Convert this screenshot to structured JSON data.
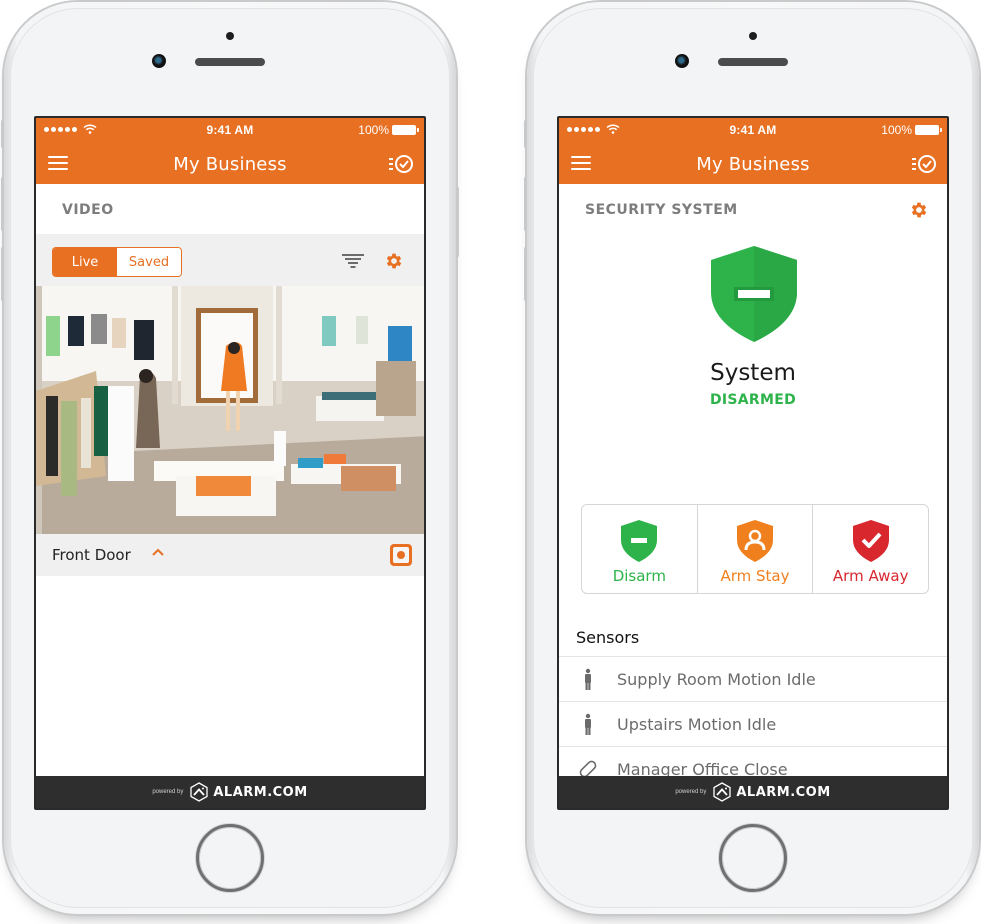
{
  "status_bar": {
    "time": "9:41 AM",
    "battery": "100%",
    "signal_bars": 5
  },
  "header": {
    "title": "My Business",
    "left_icon": "menu-icon",
    "right_icon": "task-checklist-icon"
  },
  "colors": {
    "brand_orange": "#e87022",
    "disarm_green": "#2db34a",
    "arm_stay_orange": "#f07f1e",
    "arm_away_red": "#d9272e",
    "footer_dark": "#2e2e2e"
  },
  "footer": {
    "powered_by": "powered by",
    "brand": "ALARM.COM"
  },
  "video_screen": {
    "section_title": "VIDEO",
    "segmented": {
      "options": [
        "Live",
        "Saved"
      ],
      "selected": "Live"
    },
    "toolbar_icons": [
      "filter-icon",
      "settings-gear-icon"
    ],
    "feed": {
      "description": "Live camera view of retail clothing store interior"
    },
    "camera_name": "Front Door",
    "camera_icons": [
      "chevron-up-icon",
      "record-icon"
    ]
  },
  "security_screen": {
    "section_title": "SECURITY SYSTEM",
    "system_label": "System",
    "system_state": "DISARMED",
    "arm_buttons": [
      {
        "label": "Disarm",
        "icon": "shield-minus-icon",
        "color": "#2db34a"
      },
      {
        "label": "Arm Stay",
        "icon": "shield-person-icon",
        "color": "#f07f1e"
      },
      {
        "label": "Arm Away",
        "icon": "shield-check-icon",
        "color": "#d9272e"
      }
    ],
    "sensors_title": "Sensors",
    "sensors": [
      {
        "name": "Supply Room Motion Idle",
        "icon": "motion-person-icon"
      },
      {
        "name": "Upstairs Motion Idle",
        "icon": "motion-person-icon"
      },
      {
        "name": "Manager Office Close",
        "icon": "door-contact-icon"
      }
    ]
  }
}
